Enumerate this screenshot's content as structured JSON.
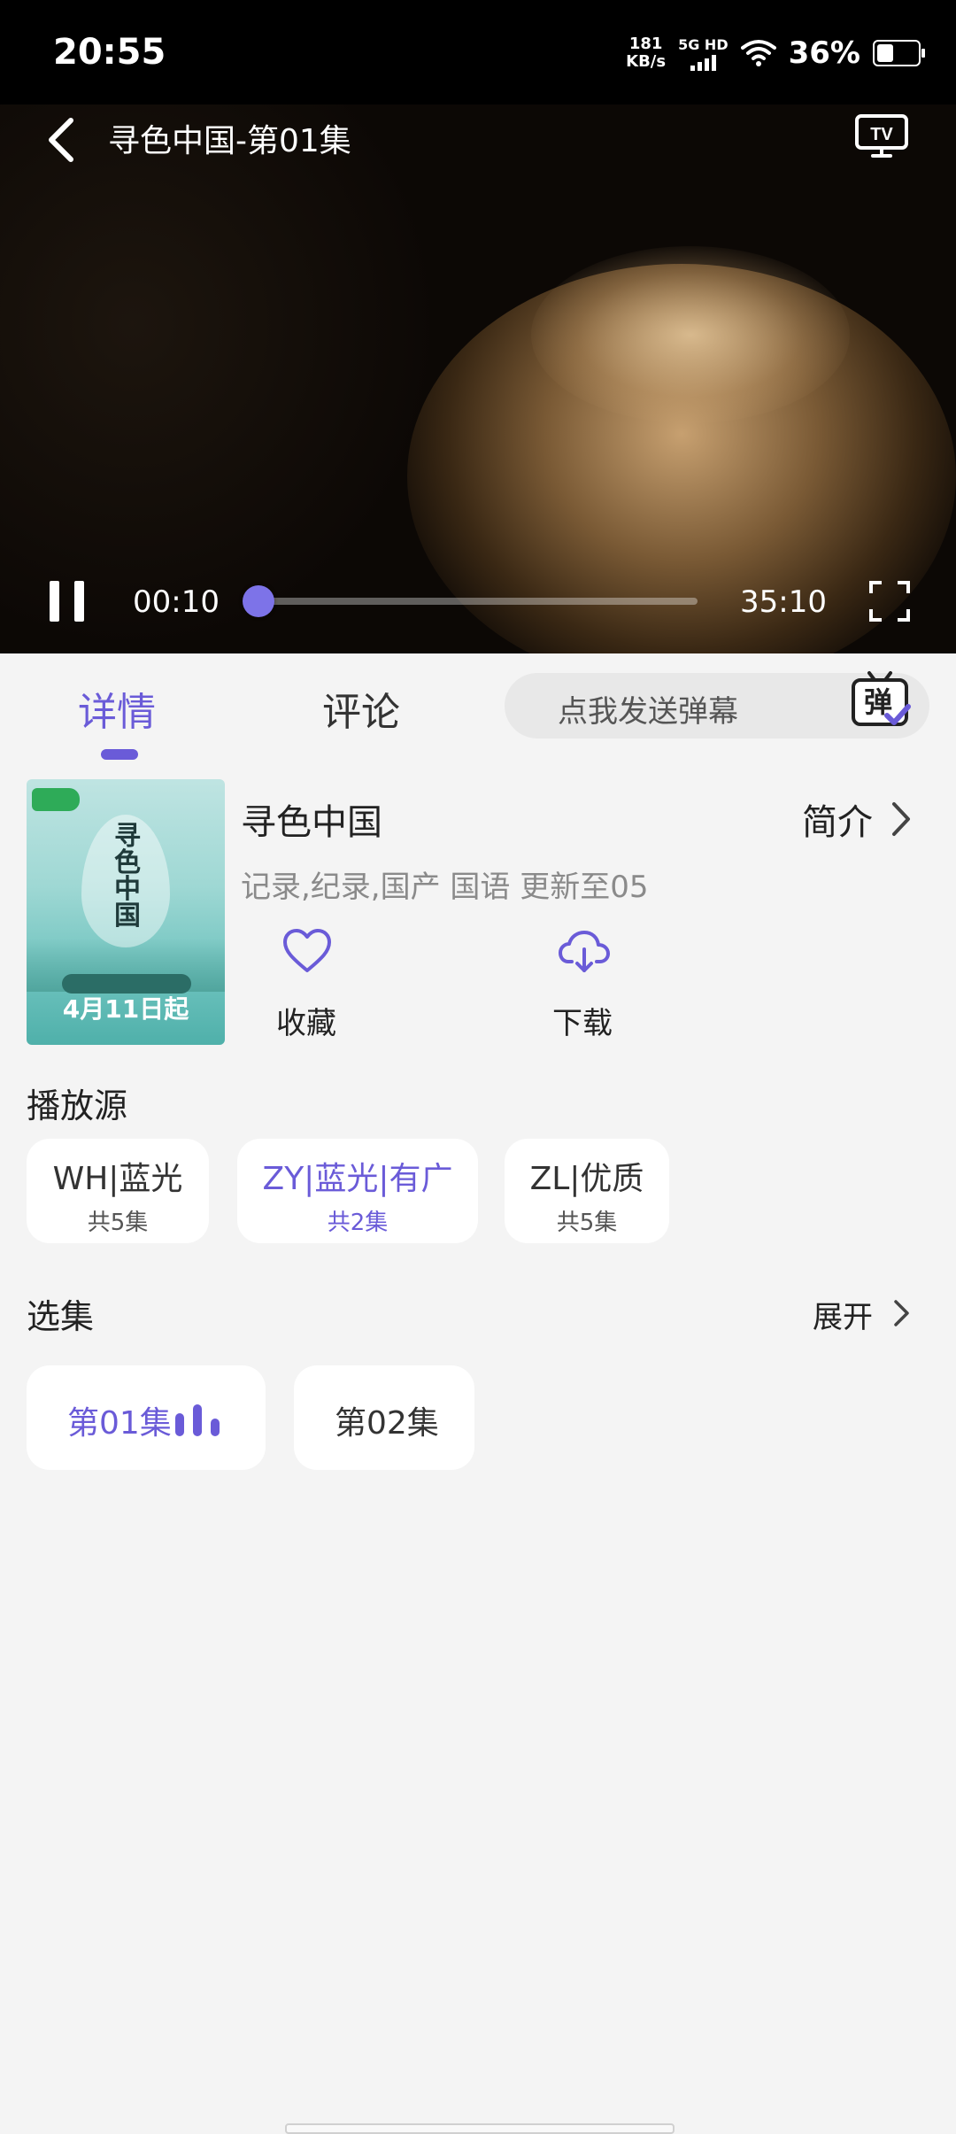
{
  "status_bar": {
    "time": "20:55",
    "net_speed_value": "181",
    "net_speed_unit": "KB/s",
    "network_type": "5G HD",
    "battery_percent": "36%",
    "battery_level": 0.36
  },
  "player": {
    "title": "寻色中国-第01集",
    "current_time": "00:10",
    "total_time": "35:10",
    "progress": 0.005
  },
  "tabs": {
    "details": "详情",
    "comments": "评论"
  },
  "danmu": {
    "placeholder": "点我发送弹幕",
    "icon_label": "弹"
  },
  "show": {
    "title": "寻色中国",
    "intro_label": "简介",
    "meta": "记录,纪录,国产 国语 更新至05",
    "poster_title": "寻色中国",
    "poster_date": "4月11日起",
    "favorite_label": "收藏",
    "download_label": "下载"
  },
  "sources": {
    "title": "播放源",
    "items": [
      {
        "name": "WH|蓝光",
        "count": "共5集",
        "active": false
      },
      {
        "name": "ZY|蓝光|有广",
        "count": "共2集",
        "active": true
      },
      {
        "name": "ZL|优质",
        "count": "共5集",
        "active": false
      }
    ]
  },
  "episodes": {
    "title": "选集",
    "expand_label": "展开",
    "items": [
      {
        "label": "第01集",
        "active": true
      },
      {
        "label": "第02集",
        "active": false
      }
    ]
  },
  "colors": {
    "accent": "#6a5bd8",
    "background": "#f4f4f4"
  }
}
